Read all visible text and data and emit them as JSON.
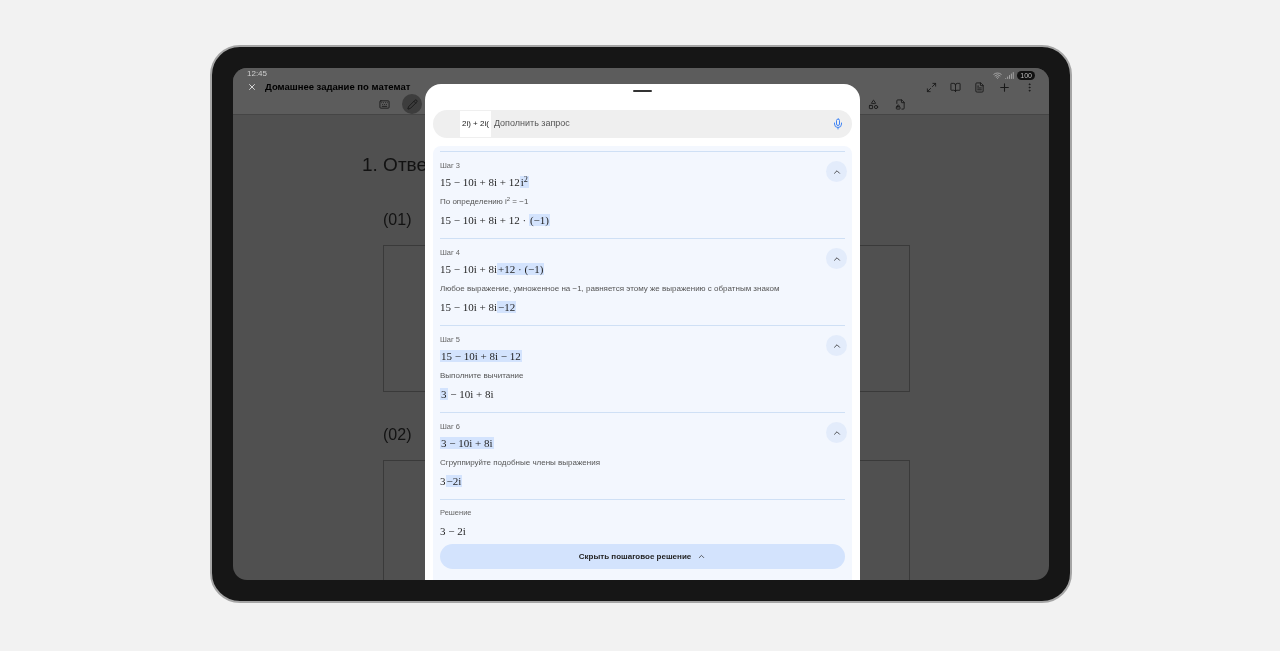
{
  "status_bar": {
    "time": "12:45",
    "battery": "100"
  },
  "app_bar": {
    "title": "Домашнее задание по математ"
  },
  "toolbar": [
    {
      "kind": "keyboard",
      "selected": false
    },
    {
      "kind": "pen",
      "selected": true
    }
  ],
  "document": {
    "heading": "1. Отве",
    "items": [
      {
        "label": "(01)"
      },
      {
        "label": "(02)"
      }
    ]
  },
  "sheet": {
    "search": {
      "value": "2i) + 2i(",
      "placeholder": "Дополнить запрос"
    },
    "steps": [
      {
        "label": "Шаг 3",
        "expanded": true,
        "before": [
          {
            "text": "15 − 10i + 8i + 12",
            "highlighted": false
          },
          {
            "text": "i$^{2}$",
            "highlighted": true
          }
        ],
        "explanation": "По определению  i$^{2}$ = −1",
        "after": [
          {
            "text": "15 − 10i + 8i + 12 · ",
            "highlighted": false
          },
          {
            "text": "(−1)",
            "highlighted": true
          }
        ]
      },
      {
        "label": "Шаг 4",
        "expanded": true,
        "before": [
          {
            "text": "15 − 10i + 8i",
            "highlighted": false
          },
          {
            "text": "+12 · (−1)",
            "highlighted": true
          }
        ],
        "explanation": "Любое выражение, умноженное на  −1, равняется этому же выражению с обратным знаком",
        "after": [
          {
            "text": "15 − 10i + 8i",
            "highlighted": false
          },
          {
            "text": "−12",
            "highlighted": true
          }
        ]
      },
      {
        "label": "Шаг 5",
        "expanded": true,
        "before": [
          {
            "text": "15 − 10i + 8i − 12",
            "highlighted": true
          }
        ],
        "explanation": "Выполните вычитание",
        "after": [
          {
            "text": "3",
            "highlighted": true
          },
          {
            "text": " − 10i + 8i",
            "highlighted": false
          }
        ]
      },
      {
        "label": "Шаг 6",
        "expanded": true,
        "before": [
          {
            "text": "3 − 10i + 8i",
            "highlighted": true
          }
        ],
        "explanation": "Сгруппируйте подобные члены выражения",
        "after": [
          {
            "text": "3",
            "highlighted": false
          },
          {
            "text": "−2i",
            "highlighted": true
          }
        ]
      }
    ],
    "solution": {
      "label": "Решение",
      "expression": "3 − 2i"
    },
    "toggle_button": "Скрыть пошаговое решение"
  }
}
